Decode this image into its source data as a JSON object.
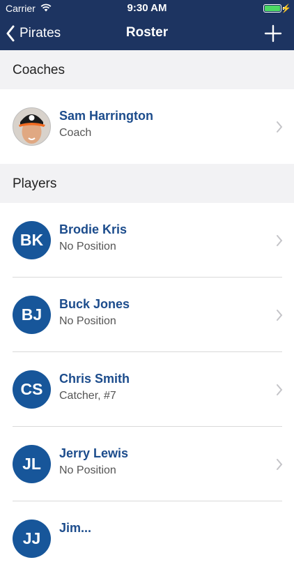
{
  "status_bar": {
    "carrier": "Carrier",
    "time": "9:30 AM"
  },
  "nav": {
    "back_label": "Pirates",
    "title": "Roster"
  },
  "sections": {
    "coaches": {
      "header": "Coaches"
    },
    "players": {
      "header": "Players"
    }
  },
  "coaches": [
    {
      "name": "Sam Harrington",
      "role": "Coach"
    }
  ],
  "players": [
    {
      "initials": "BK",
      "name": "Brodie Kris",
      "position": "No Position"
    },
    {
      "initials": "BJ",
      "name": "Buck Jones",
      "position": "No Position"
    },
    {
      "initials": "CS",
      "name": "Chris Smith",
      "position": "Catcher, #7"
    },
    {
      "initials": "JL",
      "name": "Jerry Lewis",
      "position": "No Position"
    },
    {
      "initials": "JJ",
      "name": "Jim..."
    }
  ],
  "colors": {
    "nav_background": "#1d3461",
    "avatar": "#17569a",
    "name_text": "#1c4c8c"
  }
}
